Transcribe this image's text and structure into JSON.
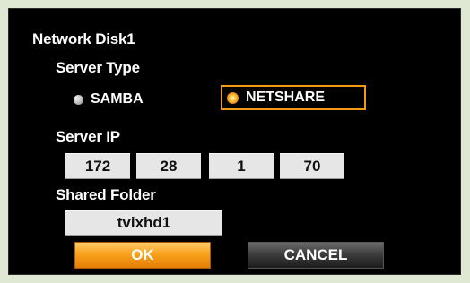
{
  "dialog": {
    "title": "Network Disk1"
  },
  "server_type": {
    "label": "Server Type",
    "options": [
      {
        "label": "SAMBA",
        "selected": false
      },
      {
        "label": "NETSHARE",
        "selected": true
      }
    ]
  },
  "server_ip": {
    "label": "Server IP",
    "octets": [
      "172",
      "28",
      "1",
      "70"
    ]
  },
  "shared_folder": {
    "label": "Shared Folder",
    "value": "tvixhd1"
  },
  "buttons": {
    "ok": "OK",
    "cancel": "CANCEL"
  },
  "colors": {
    "accent": "#f29a16",
    "background": "#000000",
    "field": "#e6e6e6"
  }
}
